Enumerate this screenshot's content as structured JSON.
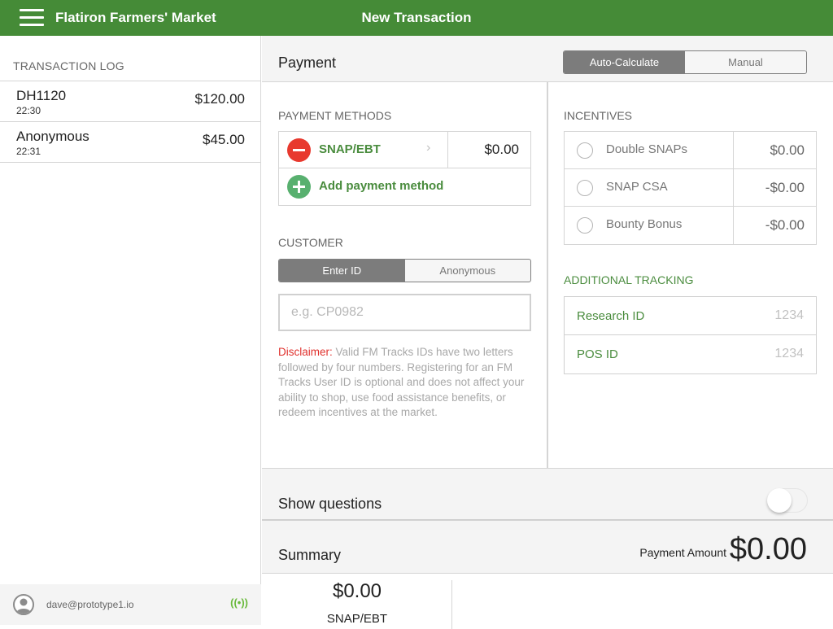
{
  "topbar": {
    "app_title": "Flatiron Farmers' Market",
    "page_title": "New Transaction",
    "brand_color": "#458b37"
  },
  "sidebar": {
    "log_header": "TRANSACTION LOG",
    "transactions": [
      {
        "name": "DH1120",
        "time": "22:30",
        "amount": "$120.00"
      },
      {
        "name": "Anonymous",
        "time": "22:31",
        "amount": "$45.00"
      }
    ],
    "footer": {
      "user_email": "dave@prototype1.io",
      "status_icon": "((•))"
    }
  },
  "payment": {
    "title": "Payment",
    "mode_toggle": {
      "options": [
        "Auto-Calculate",
        "Manual"
      ],
      "selected": "Auto-Calculate"
    },
    "methods_label": "PAYMENT METHODS",
    "methods": [
      {
        "name": "SNAP/EBT",
        "amount": "$0.00",
        "chevron": "›"
      }
    ],
    "add_method_label": "Add payment method"
  },
  "customer": {
    "label": "CUSTOMER",
    "mode_toggle": {
      "options": [
        "Enter ID",
        "Anonymous"
      ],
      "selected": "Enter ID"
    },
    "id_input": {
      "value": "",
      "placeholder": "e.g. CP0982"
    },
    "disclaimer_prefix": "Disclaimer:",
    "disclaimer_text": " Valid FM Tracks IDs have two letters followed by four numbers. Registering for an FM Tracks User ID is optional and does not affect your ability to shop, use food assistance benefits, or redeem incentives at the market."
  },
  "incentives": {
    "label": "INCENTIVES",
    "items": [
      {
        "name": "Double SNAPs",
        "amount": "$0.00",
        "selected": false
      },
      {
        "name": "SNAP CSA",
        "amount": "-$0.00",
        "selected": false
      },
      {
        "name": "Bounty Bonus",
        "amount": "-$0.00",
        "selected": false
      }
    ]
  },
  "tracking": {
    "label": "ADDITIONAL TRACKING",
    "fields": [
      {
        "label": "Research ID",
        "placeholder": "1234"
      },
      {
        "label": "POS ID",
        "placeholder": "1234"
      }
    ]
  },
  "questions": {
    "label": "Show questions",
    "enabled": false
  },
  "summary": {
    "title": "Summary",
    "payment_amount_label": "Payment Amount",
    "payment_amount": "$0.00",
    "items": [
      {
        "amount": "$0.00",
        "name": "SNAP/EBT"
      }
    ]
  }
}
